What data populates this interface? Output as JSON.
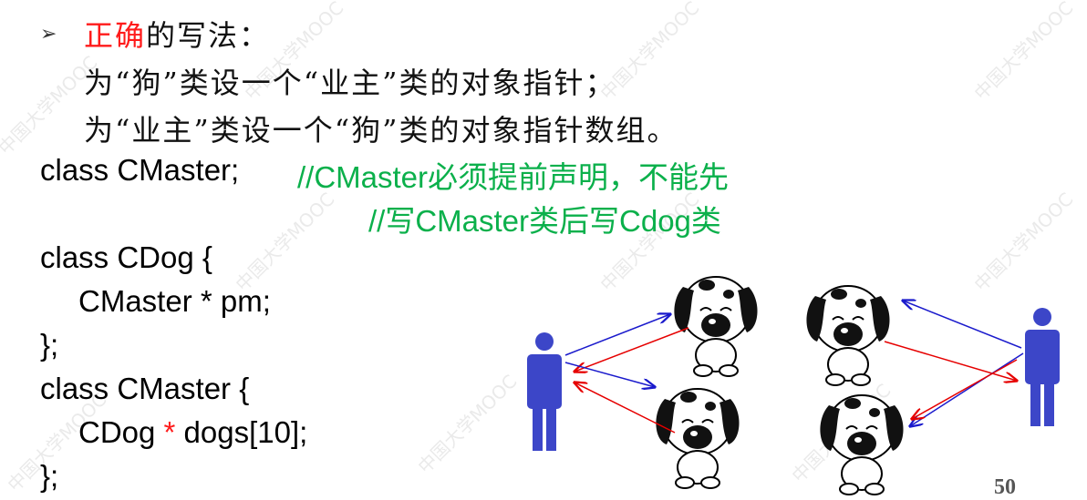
{
  "heading": {
    "bullet": "➢",
    "highlight": "正确",
    "rest": "的写法："
  },
  "explain": [
    "为“狗”类设一个“业主”类的对象指针；",
    "为“业主”类设一个“狗”类的对象指针数组。"
  ],
  "code": {
    "line1": "class CMaster;",
    "comment1": "//CMaster必须提前声明，不能先",
    "comment2": "//写CMaster类后写Cdog类",
    "line3": "class CDog  {",
    "line4": "CMaster * pm;",
    "line5": "};",
    "line6": "class CMaster  {",
    "line7a": "CDog ",
    "line7star": "*",
    "line7b": " dogs[10];",
    "line8": "};"
  },
  "watermark": "中国大学MOOC",
  "page_number": "50",
  "colors": {
    "comment": "#0bb04b",
    "highlight": "#ff1a1a",
    "person": "#3c46c8",
    "arrow_blue": "#1a1acc",
    "arrow_red": "#e60000"
  }
}
